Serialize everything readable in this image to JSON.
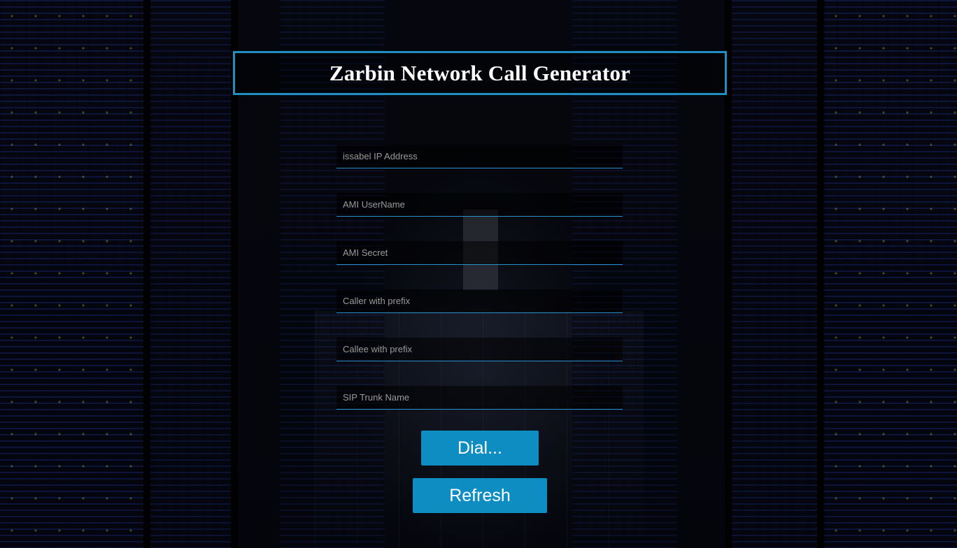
{
  "header": {
    "title": "Zarbin Network Call Generator"
  },
  "form": {
    "fields": [
      {
        "placeholder": "issabel IP Address",
        "value": ""
      },
      {
        "placeholder": "AMI UserName",
        "value": ""
      },
      {
        "placeholder": "AMI Secret",
        "value": ""
      },
      {
        "placeholder": "Caller with prefix",
        "value": ""
      },
      {
        "placeholder": "Callee with prefix",
        "value": ""
      },
      {
        "placeholder": "SIP Trunk Name",
        "value": ""
      }
    ]
  },
  "actions": {
    "dial_label": "Dial...",
    "refresh_label": "Refresh"
  },
  "colors": {
    "accent": "#0e8dc2",
    "title_border": "#1d8fc0",
    "field_underline": "#2a8fcf",
    "background": "#05070f"
  }
}
